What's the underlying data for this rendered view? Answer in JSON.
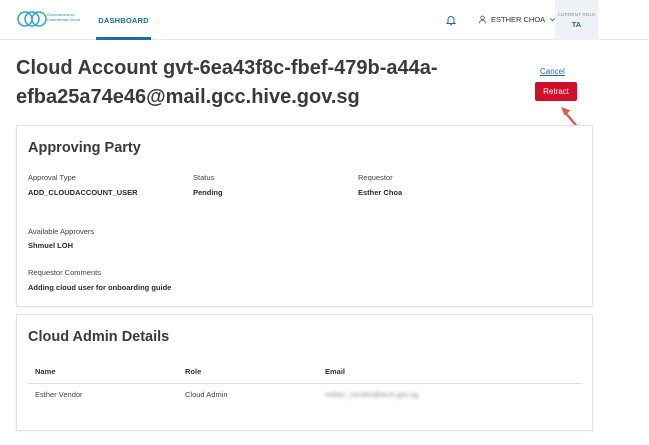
{
  "header": {
    "logo_text": "Government on Commercial Cloud",
    "nav_tab": "DASHBOARD",
    "user_name": "ESTHER CHOA",
    "role_caption": "CURRENT ROLE",
    "role_value": "TA"
  },
  "page": {
    "title": "Cloud Account gvt-6ea43f8c-fbef-479b-a44a-efba25a74e46@mail.gcc.hive.gov.sg",
    "cancel_label": "Cancel",
    "retract_label": "Retract",
    "accent_color": "#d30e2a",
    "link_color": "#1c6da5"
  },
  "approving_party": {
    "title": "Approving Party",
    "approval_type_label": "Approval Type",
    "approval_type_value": "ADD_CLOUDACCOUNT_USER",
    "status_label": "Status",
    "status_value": "Pending",
    "requestor_label": "Requestor",
    "requestor_value": "Esther Choa",
    "approvers_label": "Available Approvers",
    "approvers_value": "Shmuel LOH",
    "comments_label": "Requestor Comments",
    "comments_value": "Adding cloud user for onboarding guide"
  },
  "admin_details": {
    "title": "Cloud Admin Details",
    "columns": [
      "Name",
      "Role",
      "Email"
    ],
    "rows": [
      {
        "name": "Esther Vendor",
        "role": "Cloud Admin",
        "email": "esther_vendor@tech.gov.sg"
      }
    ]
  }
}
